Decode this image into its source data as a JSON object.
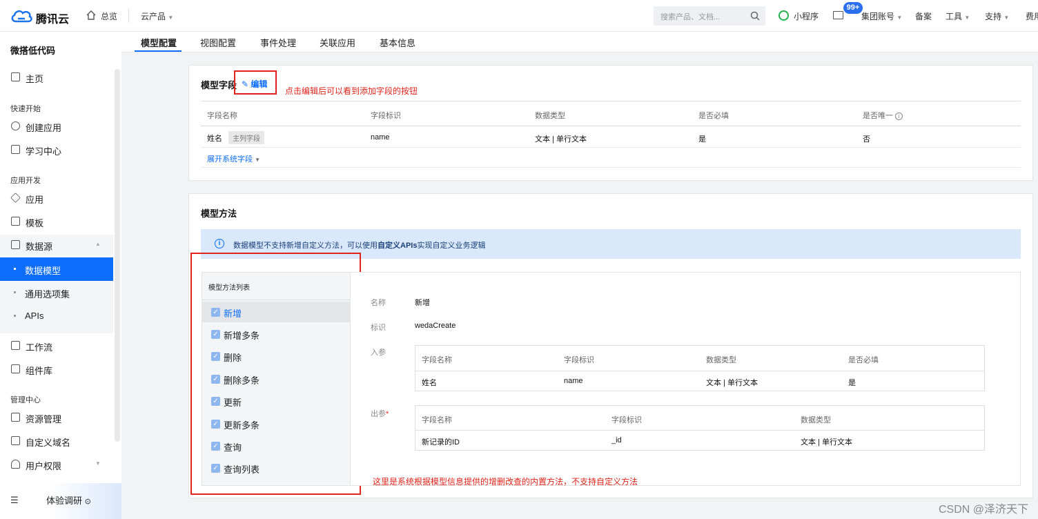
{
  "topbar": {
    "brand": "腾讯云",
    "overview": "总览",
    "products": "云产品",
    "search_placeholder": "搜索产品、文档...",
    "mini_program": "小程序",
    "badge": "99+",
    "group_account": "集团账号",
    "filing": "备案",
    "tools": "工具",
    "support": "支持",
    "fees": "费用"
  },
  "sidebar": {
    "title": "微搭低代码",
    "home": "主页",
    "section_quickstart": "快速开始",
    "create_app": "创建应用",
    "learning": "学习中心",
    "section_dev": "应用开发",
    "apps": "应用",
    "templates": "模板",
    "datasource": "数据源",
    "data_model": "数据模型",
    "options": "通用选项集",
    "apis": "APIs",
    "workflow": "工作流",
    "components": "组件库",
    "section_admin": "管理中心",
    "resources": "资源管理",
    "domains": "自定义域名",
    "permissions": "用户权限",
    "survey": "体验调研"
  },
  "tabs": [
    "模型配置",
    "视图配置",
    "事件处理",
    "关联应用",
    "基本信息"
  ],
  "fields_card": {
    "title": "模型字段",
    "edit": "编辑",
    "annotation": "点击编辑后可以看到添加字段的按钮",
    "headers": [
      "字段名称",
      "字段标识",
      "数据类型",
      "是否必填",
      "是否唯一"
    ],
    "row": {
      "name": "姓名",
      "tag": "主列字段",
      "key": "name",
      "type": "文本 | 单行文本",
      "required": "是",
      "unique": "否"
    },
    "expand": "展开系统字段"
  },
  "methods_card": {
    "title": "模型方法",
    "info_text": "数据模型不支持新增自定义方法，可以使用",
    "info_link": "自定义APIs",
    "info_tail": "实现自定义业务逻辑",
    "list_title": "模型方法列表",
    "methods": [
      "新增",
      "新增多条",
      "删除",
      "删除多条",
      "更新",
      "更新多条",
      "查询",
      "查询列表"
    ],
    "annotation": "这里是系统根据模型信息提供的增删改查的内置方法，不支持自定义方法"
  },
  "detail": {
    "name_label": "名称",
    "name_value": "新增",
    "id_label": "标识",
    "id_value": "wedaCreate",
    "input_label": "入参",
    "output_label": "出参",
    "required_mark": "*",
    "input_headers": [
      "字段名称",
      "字段标识",
      "数据类型",
      "是否必填"
    ],
    "input_row": [
      "姓名",
      "name",
      "文本 | 单行文本",
      "是"
    ],
    "output_headers": [
      "字段名称",
      "字段标识",
      "数据类型"
    ],
    "output_row": [
      "新记录的ID",
      "_id",
      "文本 | 单行文本"
    ]
  },
  "watermark": "CSDN @泽济天下"
}
